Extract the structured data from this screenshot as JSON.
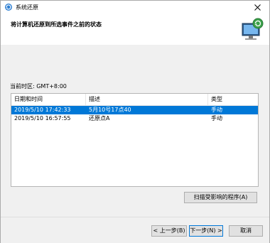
{
  "window": {
    "title": "系统还原"
  },
  "header": {
    "heading": "将计算机还原到所选事件之前的状态"
  },
  "timezone": {
    "label": "当前时区: GMT+8:00"
  },
  "table": {
    "columns": [
      "日期和时间",
      "描述",
      "类型"
    ],
    "rows": [
      {
        "datetime": "2019/5/10 17:42:33",
        "description": "5月10号17点40",
        "type": "手动",
        "selected": true
      },
      {
        "datetime": "2019/5/10 16:57:55",
        "description": "还原点A",
        "type": "手动",
        "selected": false
      }
    ]
  },
  "buttons": {
    "scan": "扫描受影响的程序(A)",
    "back": "< 上一步(B)",
    "next": "下一步(N) >",
    "cancel": "取消"
  },
  "colors": {
    "selection": "#0078d7"
  }
}
